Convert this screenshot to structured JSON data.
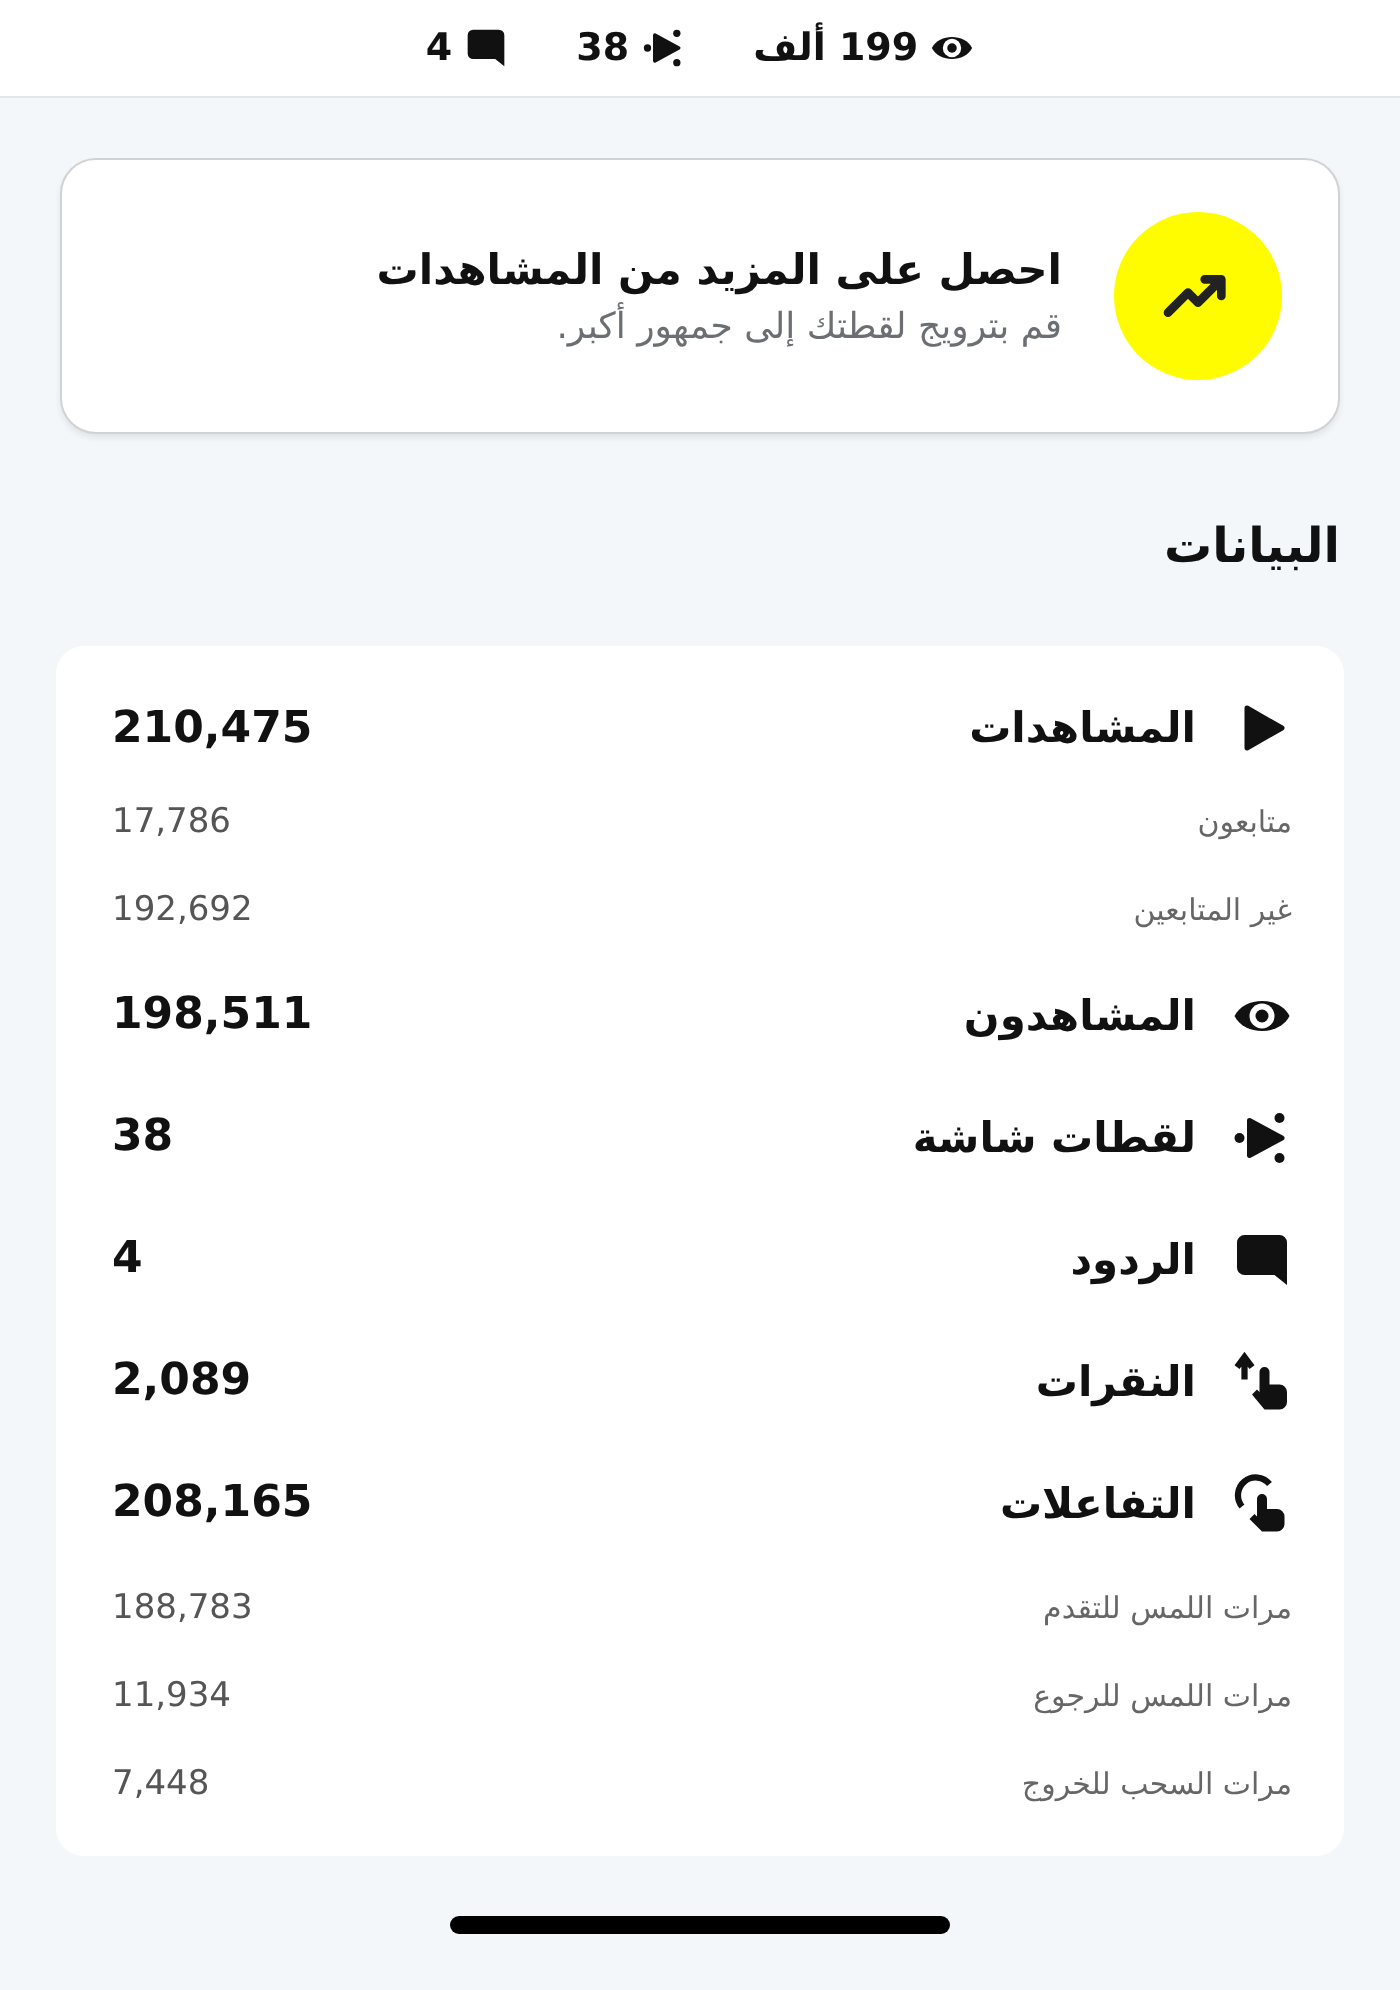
{
  "top_stats": [
    {
      "kind": "eye",
      "value": "199 ألف"
    },
    {
      "kind": "screenshot",
      "value": "38"
    },
    {
      "kind": "reply",
      "value": "4"
    }
  ],
  "promo": {
    "title": "احصل على المزيد من المشاهدات",
    "subtitle": "قم بترويج لقطتك إلى جمهور أكبر."
  },
  "section_title": "البيانات",
  "metrics": [
    {
      "kind": "play",
      "label": "المشاهدات",
      "value": "210,475",
      "children": [
        {
          "label": "متابعون",
          "value": "17,786"
        },
        {
          "label": "غير المتابعين",
          "value": "192,692"
        }
      ]
    },
    {
      "kind": "eye",
      "label": "المشاهدون",
      "value": "198,511"
    },
    {
      "kind": "screenshot",
      "label": "لقطات شاشة",
      "value": "38"
    },
    {
      "kind": "reply",
      "label": "الردود",
      "value": "4"
    },
    {
      "kind": "tap",
      "label": "النقرات",
      "value": "2,089"
    },
    {
      "kind": "swipe",
      "label": "التفاعلات",
      "value": "208,165",
      "children": [
        {
          "label": "مرات اللمس للتقدم",
          "value": "188,783"
        },
        {
          "label": "مرات اللمس للرجوع",
          "value": "11,934"
        },
        {
          "label": "مرات السحب للخروج",
          "value": "7,448"
        }
      ]
    }
  ]
}
